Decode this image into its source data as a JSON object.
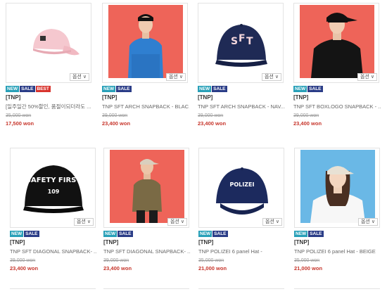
{
  "products": [
    {
      "brand": "[TNP]",
      "name": "[일주일간 50%할인, 품절이되더라도 ...",
      "original_price": "35,000 won",
      "sale_price": "17,500 won",
      "badges": [
        "NEW",
        "SALE",
        "BEST"
      ],
      "option_label": "옵션",
      "image": "pink-cap"
    },
    {
      "brand": "[TNP]",
      "name": "TNP SFT ARCH SNAPBACK - BLAC...",
      "original_price": "39,000 won",
      "sale_price": "23,400 won",
      "badges": [
        "NEW",
        "SALE"
      ],
      "option_label": "옵션",
      "image": "model-blue-tee"
    },
    {
      "brand": "[TNP]",
      "name": "TNP SFT ARCH SNAPBACK - NAV...",
      "original_price": "39,000 won",
      "sale_price": "23,400 won",
      "badges": [
        "NEW",
        "SALE"
      ],
      "option_label": "옵션",
      "image": "navy-sft-cap"
    },
    {
      "brand": "[TNP]",
      "name": "TNP SFT BOXLOGO SNAPBACK - ...",
      "original_price": "39,000 won",
      "sale_price": "23,400 won",
      "badges": [
        "NEW",
        "SALE"
      ],
      "option_label": "옵션",
      "image": "model-black-tee"
    },
    {
      "brand": "[TNP]",
      "name": "TNP SFT DIAGONAL SNAPBACK- ...",
      "original_price": "39,000 won",
      "sale_price": "23,400 won",
      "badges": [
        "NEW",
        "SALE"
      ],
      "option_label": "옵션",
      "image": "safety-first-cap",
      "cap_text_top": "SAFETY FIRST",
      "cap_text_bottom": "109"
    },
    {
      "brand": "[TNP]",
      "name": "TNP SFT DIAGONAL SNAPBACK- ...",
      "original_price": "39,000 won",
      "sale_price": "23,400 won",
      "badges": [
        "NEW",
        "SALE"
      ],
      "option_label": "옵션",
      "image": "model-olive-tee"
    },
    {
      "brand": "[TNP]",
      "name": "TNP POLIZEI 6 panel Hat -",
      "original_price": "35,000 won",
      "sale_price": "21,000 won",
      "badges": [
        "NEW",
        "SALE"
      ],
      "option_label": "옵션",
      "image": "polizei-cap",
      "cap_text_top": "POLIZEI"
    },
    {
      "brand": "[TNP]",
      "name": "TNP POLIZEI 6 panel Hat - BEIGE",
      "original_price": "35,000 won",
      "sale_price": "21,000 won",
      "badges": [
        "NEW",
        "SALE"
      ],
      "option_label": "옵션",
      "image": "model-beige-cap"
    }
  ],
  "colors": {
    "sale_price": "#c7352b",
    "badge_new": "#28a0b8",
    "badge_sale": "#2a3c87",
    "badge_best": "#d8342e",
    "photo_red_bg": "#ee6459",
    "photo_blue_bg": "#6ab8e6"
  }
}
